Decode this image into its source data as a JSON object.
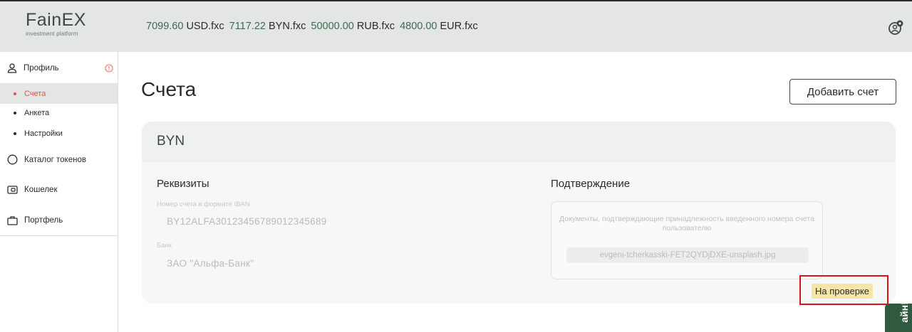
{
  "header": {
    "logo": {
      "main": "FainEX",
      "sub": "investment platform"
    },
    "balances": [
      {
        "amount": "7099.60",
        "currency": "USD.fxc"
      },
      {
        "amount": "7117.22",
        "currency": "BYN.fxc"
      },
      {
        "amount": "50000.00",
        "currency": "RUB.fxc"
      },
      {
        "amount": "4800.00",
        "currency": "EUR.fxc"
      }
    ],
    "user_icon": "user-settings-icon"
  },
  "sidebar": {
    "profile": {
      "label": "Профиль",
      "icon": "user-icon",
      "warning_icon": "warning-icon"
    },
    "profile_subitems": [
      {
        "label": "Счета",
        "active": true
      },
      {
        "label": "Анкета",
        "active": false
      },
      {
        "label": "Настройки",
        "active": false
      }
    ],
    "items": [
      {
        "label": "Каталог токенов",
        "icon": "circle-icon"
      },
      {
        "label": "Кошелек",
        "icon": "wallet-icon"
      },
      {
        "label": "Портфель",
        "icon": "briefcase-icon"
      }
    ]
  },
  "main": {
    "title": "Счета",
    "add_button": "Добавить счет",
    "account": {
      "currency": "BYN",
      "requisites_title": "Реквизиты",
      "iban_label": "Номер счета в формате IBAN",
      "iban_value": "BY12ALFA30123456789012345689",
      "bank_label": "Банк",
      "bank_value": "ЗАО \"Альфа-Банк\"",
      "confirmation_title": "Подтверждение",
      "confirmation_desc": "Документы, подтверждающие принадлежность введенного номера счета пользователю",
      "file_name": "evgeni-tcherkasski-FET2QYDjDXE-unsplash.jpg",
      "status": "На проверке"
    }
  },
  "side_tab": {
    "label": "айн!"
  },
  "colors": {
    "accent": "#d9534f",
    "brand": "#3d6b51",
    "status_bg": "#f5e6a8",
    "highlight": "#d7141d"
  }
}
